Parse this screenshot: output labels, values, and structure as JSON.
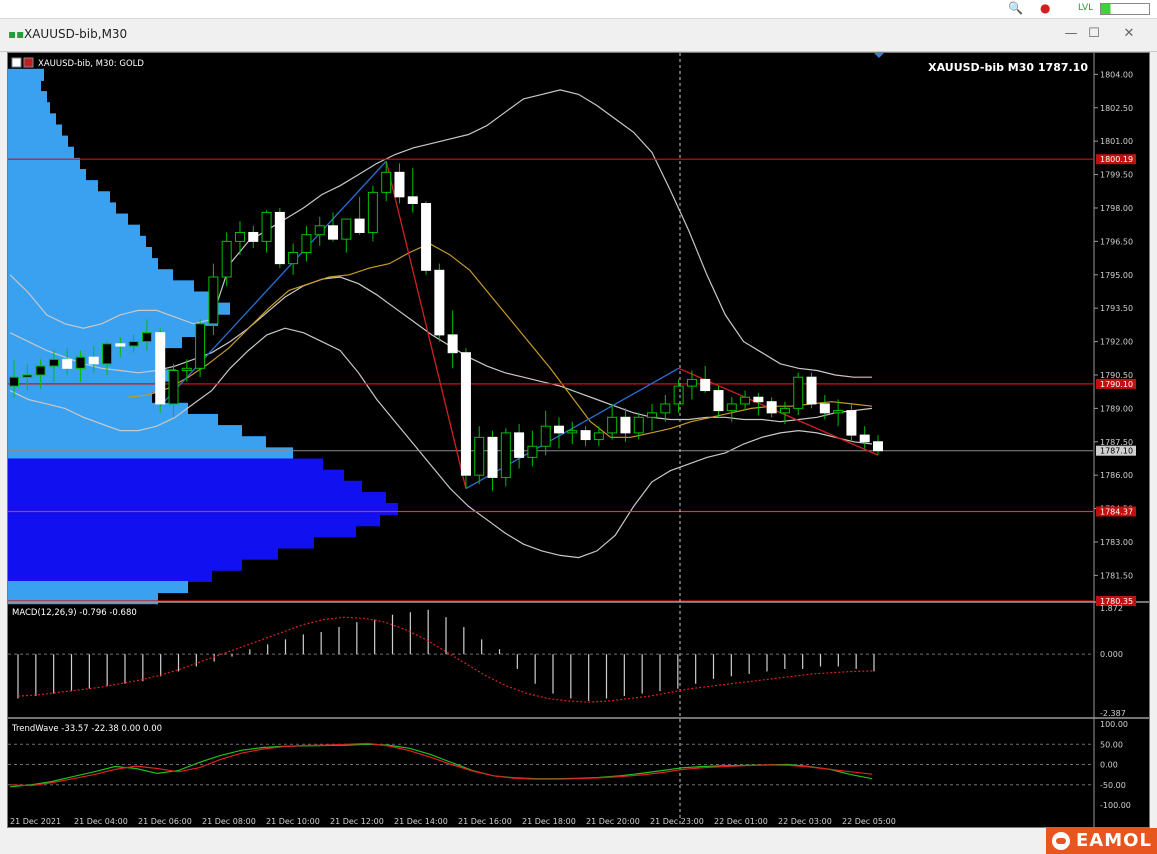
{
  "window": {
    "title": "XAUUSD-bib,M30",
    "topbar_icons": [
      "search-icon",
      "alert-icon",
      "signal-icon",
      "battery-icon"
    ],
    "topbar_lvl": "LVL"
  },
  "chart": {
    "header_text": "XAUUSD-bib, M30:  GOLD",
    "price_label": "XAUUSD-bib M30 1787.10",
    "colors": {
      "background": "#000000",
      "bull": "#ffffff",
      "bear": "#ffffff",
      "wick": "#00c000",
      "bb": "#c8c8c8",
      "ma": "#c89a2a",
      "zigzag_up": "#2a6fd0",
      "zigzag_down": "#d02020",
      "levels": "#d01010",
      "profile_light": "#3aa0f0",
      "profile_dark": "#1010f0"
    }
  },
  "chart_data": [
    {
      "type": "candlestick",
      "title": "XAUUSD-bib M30",
      "ylim": [
        1780.35,
        1804.6
      ],
      "price_ticks": [
        "1804.00",
        "1802.50",
        "1801.00",
        "1799.50",
        "1798.00",
        "1796.50",
        "1795.00",
        "1793.50",
        "1792.00",
        "1790.50",
        "1789.00",
        "1787.50",
        "1786.00",
        "1784.50",
        "1783.00",
        "1781.50"
      ],
      "level_lines": [
        {
          "value": 1800.19,
          "label": "1800.19"
        },
        {
          "value": 1790.1,
          "label": "1790.10"
        },
        {
          "value": 1784.37,
          "label": "1784.37"
        },
        {
          "value": 1780.35,
          "label": "1780.35"
        }
      ],
      "current": {
        "value": 1787.1,
        "label": "1787.10"
      },
      "x_labels": [
        "21 Dec 2021",
        "21 Dec 04:00",
        "21 Dec 06:00",
        "21 Dec 08:00",
        "21 Dec 10:00",
        "21 Dec 12:00",
        "21 Dec 14:00",
        "21 Dec 16:00",
        "21 Dec 18:00",
        "21 Dec 20:00",
        "21 Dec 23:00",
        "22 Dec 01:00",
        "22 Dec 03:00",
        "22 Dec 05:00"
      ],
      "candles": [
        {
          "o": 1790.0,
          "h": 1791.2,
          "l": 1789.5,
          "c": 1790.4
        },
        {
          "o": 1790.4,
          "h": 1791.0,
          "l": 1789.8,
          "c": 1790.5
        },
        {
          "o": 1790.5,
          "h": 1791.2,
          "l": 1789.9,
          "c": 1790.9
        },
        {
          "o": 1790.9,
          "h": 1791.6,
          "l": 1790.2,
          "c": 1791.2
        },
        {
          "o": 1791.2,
          "h": 1791.7,
          "l": 1790.5,
          "c": 1790.8
        },
        {
          "o": 1790.8,
          "h": 1791.6,
          "l": 1790.2,
          "c": 1791.3
        },
        {
          "o": 1791.3,
          "h": 1791.8,
          "l": 1790.6,
          "c": 1791.0
        },
        {
          "o": 1791.0,
          "h": 1792.0,
          "l": 1790.5,
          "c": 1791.9
        },
        {
          "o": 1791.9,
          "h": 1792.2,
          "l": 1791.3,
          "c": 1791.8
        },
        {
          "o": 1791.8,
          "h": 1792.3,
          "l": 1791.5,
          "c": 1792.0
        },
        {
          "o": 1792.0,
          "h": 1793.0,
          "l": 1791.6,
          "c": 1792.4
        },
        {
          "o": 1792.4,
          "h": 1792.6,
          "l": 1788.8,
          "c": 1789.2
        },
        {
          "o": 1789.2,
          "h": 1791.0,
          "l": 1788.6,
          "c": 1790.7
        },
        {
          "o": 1790.7,
          "h": 1791.2,
          "l": 1790.2,
          "c": 1790.8
        },
        {
          "o": 1790.8,
          "h": 1793.0,
          "l": 1790.4,
          "c": 1792.8
        },
        {
          "o": 1792.8,
          "h": 1795.5,
          "l": 1792.3,
          "c": 1794.9
        },
        {
          "o": 1794.9,
          "h": 1796.9,
          "l": 1794.5,
          "c": 1796.5
        },
        {
          "o": 1796.5,
          "h": 1797.4,
          "l": 1795.9,
          "c": 1796.9
        },
        {
          "o": 1796.9,
          "h": 1797.2,
          "l": 1796.2,
          "c": 1796.5
        },
        {
          "o": 1796.5,
          "h": 1797.9,
          "l": 1796.0,
          "c": 1797.8
        },
        {
          "o": 1797.8,
          "h": 1798.0,
          "l": 1795.3,
          "c": 1795.5
        },
        {
          "o": 1795.5,
          "h": 1796.4,
          "l": 1795.0,
          "c": 1796.0
        },
        {
          "o": 1796.0,
          "h": 1797.2,
          "l": 1795.6,
          "c": 1796.8
        },
        {
          "o": 1796.8,
          "h": 1797.6,
          "l": 1796.3,
          "c": 1797.2
        },
        {
          "o": 1797.2,
          "h": 1797.8,
          "l": 1796.5,
          "c": 1796.6
        },
        {
          "o": 1796.6,
          "h": 1797.5,
          "l": 1796.0,
          "c": 1797.5
        },
        {
          "o": 1797.5,
          "h": 1798.5,
          "l": 1796.8,
          "c": 1796.9
        },
        {
          "o": 1796.9,
          "h": 1799.0,
          "l": 1796.5,
          "c": 1798.7
        },
        {
          "o": 1798.7,
          "h": 1800.1,
          "l": 1798.3,
          "c": 1799.6
        },
        {
          "o": 1799.6,
          "h": 1800.0,
          "l": 1798.2,
          "c": 1798.5
        },
        {
          "o": 1798.5,
          "h": 1799.8,
          "l": 1797.8,
          "c": 1798.2
        },
        {
          "o": 1798.2,
          "h": 1798.3,
          "l": 1795.0,
          "c": 1795.2
        },
        {
          "o": 1795.2,
          "h": 1795.5,
          "l": 1792.0,
          "c": 1792.3
        },
        {
          "o": 1792.3,
          "h": 1793.4,
          "l": 1790.8,
          "c": 1791.5
        },
        {
          "o": 1791.5,
          "h": 1791.7,
          "l": 1785.4,
          "c": 1786.0
        },
        {
          "o": 1786.0,
          "h": 1788.2,
          "l": 1785.6,
          "c": 1787.7
        },
        {
          "o": 1787.7,
          "h": 1788.0,
          "l": 1785.3,
          "c": 1785.9
        },
        {
          "o": 1785.9,
          "h": 1788.1,
          "l": 1785.5,
          "c": 1787.9
        },
        {
          "o": 1787.9,
          "h": 1788.3,
          "l": 1786.3,
          "c": 1786.8
        },
        {
          "o": 1786.8,
          "h": 1788.0,
          "l": 1786.4,
          "c": 1787.3
        },
        {
          "o": 1787.3,
          "h": 1788.9,
          "l": 1786.9,
          "c": 1788.2
        },
        {
          "o": 1788.2,
          "h": 1788.6,
          "l": 1787.2,
          "c": 1787.9
        },
        {
          "o": 1787.9,
          "h": 1788.4,
          "l": 1787.4,
          "c": 1788.0
        },
        {
          "o": 1788.0,
          "h": 1788.2,
          "l": 1787.3,
          "c": 1787.6
        },
        {
          "o": 1787.6,
          "h": 1788.2,
          "l": 1787.3,
          "c": 1787.9
        },
        {
          "o": 1787.9,
          "h": 1789.2,
          "l": 1787.6,
          "c": 1788.6
        },
        {
          "o": 1788.6,
          "h": 1789.0,
          "l": 1787.5,
          "c": 1787.9
        },
        {
          "o": 1787.9,
          "h": 1788.8,
          "l": 1787.6,
          "c": 1788.6
        },
        {
          "o": 1788.6,
          "h": 1789.2,
          "l": 1788.0,
          "c": 1788.8
        },
        {
          "o": 1788.8,
          "h": 1789.6,
          "l": 1788.4,
          "c": 1789.2
        },
        {
          "o": 1789.2,
          "h": 1790.3,
          "l": 1788.8,
          "c": 1790.0
        },
        {
          "o": 1790.0,
          "h": 1790.7,
          "l": 1789.4,
          "c": 1790.3
        },
        {
          "o": 1790.3,
          "h": 1790.9,
          "l": 1789.7,
          "c": 1789.8
        },
        {
          "o": 1789.8,
          "h": 1790.0,
          "l": 1788.6,
          "c": 1788.9
        },
        {
          "o": 1788.9,
          "h": 1789.5,
          "l": 1788.4,
          "c": 1789.2
        },
        {
          "o": 1789.2,
          "h": 1789.8,
          "l": 1788.9,
          "c": 1789.5
        },
        {
          "o": 1789.5,
          "h": 1789.7,
          "l": 1788.7,
          "c": 1789.3
        },
        {
          "o": 1789.3,
          "h": 1789.5,
          "l": 1788.6,
          "c": 1788.8
        },
        {
          "o": 1788.8,
          "h": 1789.3,
          "l": 1788.3,
          "c": 1789.0
        },
        {
          "o": 1789.0,
          "h": 1790.6,
          "l": 1788.7,
          "c": 1790.4
        },
        {
          "o": 1790.4,
          "h": 1790.6,
          "l": 1789.0,
          "c": 1789.2
        },
        {
          "o": 1789.2,
          "h": 1789.6,
          "l": 1788.5,
          "c": 1788.8
        },
        {
          "o": 1788.8,
          "h": 1789.4,
          "l": 1788.2,
          "c": 1788.9
        },
        {
          "o": 1788.9,
          "h": 1789.2,
          "l": 1787.5,
          "c": 1787.8
        },
        {
          "o": 1787.8,
          "h": 1788.2,
          "l": 1787.2,
          "c": 1787.5
        },
        {
          "o": 1787.5,
          "h": 1787.8,
          "l": 1786.9,
          "c": 1787.1
        }
      ],
      "bb_upper": [
        1795.0,
        1794.2,
        1793.2,
        1792.8,
        1792.6,
        1792.8,
        1793.2,
        1793.4,
        1793.4,
        1793.1,
        1792.8,
        1793.0,
        1795.5,
        1796.5,
        1797.0,
        1797.5,
        1798.0,
        1798.6,
        1799.0,
        1799.5,
        1800.0,
        1800.4,
        1800.7,
        1800.9,
        1801.1,
        1801.3,
        1801.7,
        1802.3,
        1802.9,
        1803.1,
        1803.3,
        1803.1,
        1802.6,
        1802.0,
        1801.4,
        1800.5,
        1798.8,
        1797.0,
        1795.0,
        1793.2,
        1792.0,
        1791.5,
        1791.0,
        1790.8,
        1790.7,
        1790.5,
        1790.4,
        1790.4
      ],
      "bb_middle": [
        1792.4,
        1792.0,
        1791.6,
        1791.3,
        1791.0,
        1790.8,
        1790.7,
        1790.6,
        1790.7,
        1790.9,
        1791.2,
        1791.5,
        1792.0,
        1792.6,
        1793.3,
        1794.0,
        1794.5,
        1794.8,
        1794.9,
        1794.6,
        1794.1,
        1793.5,
        1792.9,
        1792.3,
        1791.8,
        1791.3,
        1790.9,
        1790.6,
        1790.4,
        1790.2,
        1790.0,
        1789.7,
        1789.4,
        1789.1,
        1788.8,
        1788.6,
        1788.5,
        1788.5,
        1788.6,
        1788.6,
        1788.5,
        1788.5,
        1788.4,
        1788.5,
        1788.6,
        1788.8,
        1788.9,
        1789.0
      ],
      "bb_lower": [
        1789.8,
        1789.4,
        1789.2,
        1789.0,
        1788.6,
        1788.3,
        1788.0,
        1788.0,
        1788.2,
        1788.6,
        1789.2,
        1789.8,
        1790.8,
        1791.6,
        1792.3,
        1792.6,
        1792.4,
        1792.0,
        1791.6,
        1790.6,
        1789.4,
        1788.4,
        1787.4,
        1786.4,
        1785.4,
        1784.6,
        1784.0,
        1783.4,
        1782.9,
        1782.6,
        1782.4,
        1782.3,
        1782.6,
        1783.3,
        1784.6,
        1785.7,
        1786.2,
        1786.5,
        1786.8,
        1787.0,
        1787.4,
        1787.7,
        1787.9,
        1788.0,
        1787.9,
        1787.7,
        1787.5,
        1787.4
      ],
      "ma": [
        1789.5,
        1789.6,
        1789.9,
        1790.4,
        1791.0,
        1791.7,
        1792.6,
        1793.5,
        1794.3,
        1794.6,
        1794.9,
        1795.0,
        1795.3,
        1795.5,
        1796.0,
        1796.4,
        1795.9,
        1795.2,
        1794.1,
        1793.0,
        1791.9,
        1790.8,
        1789.6,
        1788.4,
        1787.7,
        1787.7,
        1787.9,
        1788.1,
        1788.4,
        1788.6,
        1788.8,
        1789.0,
        1789.1,
        1789.1,
        1789.2,
        1789.3,
        1789.2,
        1789.1
      ],
      "zigzag": [
        {
          "i": 11,
          "v": 1789.1
        },
        {
          "i": 28,
          "v": 1800.1
        },
        {
          "i": 34,
          "v": 1785.4
        },
        {
          "i": 50,
          "v": 1790.8
        },
        {
          "i": 65,
          "v": 1786.9
        }
      ],
      "profile": [
        {
          "v": 1804.0,
          "w": 0.12
        },
        {
          "v": 1803.5,
          "w": 0.11
        },
        {
          "v": 1803.0,
          "w": 0.13
        },
        {
          "v": 1802.5,
          "w": 0.14
        },
        {
          "v": 1802.0,
          "w": 0.16
        },
        {
          "v": 1801.5,
          "w": 0.18
        },
        {
          "v": 1801.0,
          "w": 0.2
        },
        {
          "v": 1800.5,
          "w": 0.22
        },
        {
          "v": 1800.0,
          "w": 0.24
        },
        {
          "v": 1799.5,
          "w": 0.26
        },
        {
          "v": 1799.0,
          "w": 0.3
        },
        {
          "v": 1798.5,
          "w": 0.34
        },
        {
          "v": 1798.0,
          "w": 0.36
        },
        {
          "v": 1797.5,
          "w": 0.4
        },
        {
          "v": 1797.0,
          "w": 0.44
        },
        {
          "v": 1796.5,
          "w": 0.46
        },
        {
          "v": 1796.0,
          "w": 0.48
        },
        {
          "v": 1795.5,
          "w": 0.5
        },
        {
          "v": 1795.0,
          "w": 0.55
        },
        {
          "v": 1794.5,
          "w": 0.62
        },
        {
          "v": 1794.0,
          "w": 0.68
        },
        {
          "v": 1793.5,
          "w": 0.74
        },
        {
          "v": 1793.0,
          "w": 0.7
        },
        {
          "v": 1792.5,
          "w": 0.65
        },
        {
          "v": 1792.0,
          "w": 0.58
        },
        {
          "v": 1791.5,
          "w": 0.52
        },
        {
          "v": 1791.0,
          "w": 0.5
        },
        {
          "v": 1790.5,
          "w": 0.56
        },
        {
          "v": 1790.0,
          "w": 0.52
        },
        {
          "v": 1789.5,
          "w": 0.48
        },
        {
          "v": 1789.0,
          "w": 0.6
        },
        {
          "v": 1788.5,
          "w": 0.7
        },
        {
          "v": 1788.0,
          "w": 0.78
        },
        {
          "v": 1787.5,
          "w": 0.86
        },
        {
          "v": 1787.0,
          "w": 0.95
        },
        {
          "v": 1786.5,
          "w": 1.05
        },
        {
          "v": 1786.0,
          "w": 1.12
        },
        {
          "v": 1785.5,
          "w": 1.18
        },
        {
          "v": 1785.0,
          "w": 1.26
        },
        {
          "v": 1784.5,
          "w": 1.3
        },
        {
          "v": 1784.0,
          "w": 1.24
        },
        {
          "v": 1783.5,
          "w": 1.16
        },
        {
          "v": 1783.0,
          "w": 1.02
        },
        {
          "v": 1782.5,
          "w": 0.9
        },
        {
          "v": 1782.0,
          "w": 0.78
        },
        {
          "v": 1781.5,
          "w": 0.68
        },
        {
          "v": 1781.0,
          "w": 0.6
        },
        {
          "v": 1780.5,
          "w": 0.5
        }
      ],
      "poc": 1784.37
    },
    {
      "type": "bar",
      "title": "MACD(12,26,9) -0.796 -0.680",
      "ylim": [
        -2.387,
        1.872
      ],
      "ticks": [
        "1.872",
        "0.000",
        "-2.387"
      ],
      "histogram": [
        -1.8,
        -1.7,
        -1.6,
        -1.5,
        -1.4,
        -1.3,
        -1.2,
        -1.1,
        -0.9,
        -0.7,
        -0.5,
        -0.3,
        -0.1,
        0.2,
        0.4,
        0.6,
        0.8,
        0.9,
        1.1,
        1.3,
        1.4,
        1.6,
        1.7,
        1.8,
        1.5,
        1.1,
        0.6,
        0.2,
        -0.6,
        -1.2,
        -1.6,
        -1.8,
        -1.9,
        -1.8,
        -1.7,
        -1.6,
        -1.5,
        -1.4,
        -1.2,
        -1.0,
        -0.9,
        -0.8,
        -0.7,
        -0.6,
        -0.6,
        -0.5,
        -0.5,
        -0.6,
        -0.7
      ],
      "signal": [
        -1.7,
        -1.65,
        -1.55,
        -1.45,
        -1.35,
        -1.2,
        -1.05,
        -0.85,
        -0.6,
        -0.3,
        0.0,
        0.3,
        0.6,
        0.9,
        1.2,
        1.4,
        1.5,
        1.45,
        1.3,
        1.0,
        0.6,
        0.1,
        -0.4,
        -0.9,
        -1.3,
        -1.6,
        -1.8,
        -1.9,
        -1.95,
        -1.9,
        -1.8,
        -1.7,
        -1.55,
        -1.4,
        -1.3,
        -1.2,
        -1.1,
        -1.0,
        -0.9,
        -0.8,
        -0.75,
        -0.7,
        -0.68
      ]
    },
    {
      "type": "line",
      "title": "TrendWave -33.57 -22.38 0.00 0.00",
      "ylim": [
        -100,
        100
      ],
      "ticks": [
        "100.00",
        "50.00",
        "0.00",
        "-50.00",
        "-100.00"
      ],
      "series": [
        {
          "color": "#20c020",
          "values": [
            -55,
            -50,
            -42,
            -30,
            -18,
            -5,
            -10,
            -22,
            -15,
            5,
            22,
            35,
            42,
            45,
            46,
            47,
            48,
            50,
            48,
            40,
            25,
            5,
            -15,
            -28,
            -33,
            -35,
            -35,
            -34,
            -32,
            -28,
            -22,
            -15,
            -8,
            -5,
            -3,
            -2,
            -1,
            0,
            -5,
            -12,
            -25,
            -35
          ]
        },
        {
          "color": "#e02020",
          "values": [
            -50,
            -52,
            -45,
            -35,
            -25,
            -12,
            -4,
            -10,
            -18,
            -8,
            12,
            28,
            38,
            44,
            47,
            48,
            50,
            52,
            46,
            34,
            18,
            0,
            -16,
            -28,
            -34,
            -36,
            -36,
            -35,
            -33,
            -30,
            -26,
            -20,
            -12,
            -8,
            -5,
            -3,
            -1,
            -2,
            -6,
            -12,
            -18,
            -24
          ]
        }
      ]
    }
  ]
}
